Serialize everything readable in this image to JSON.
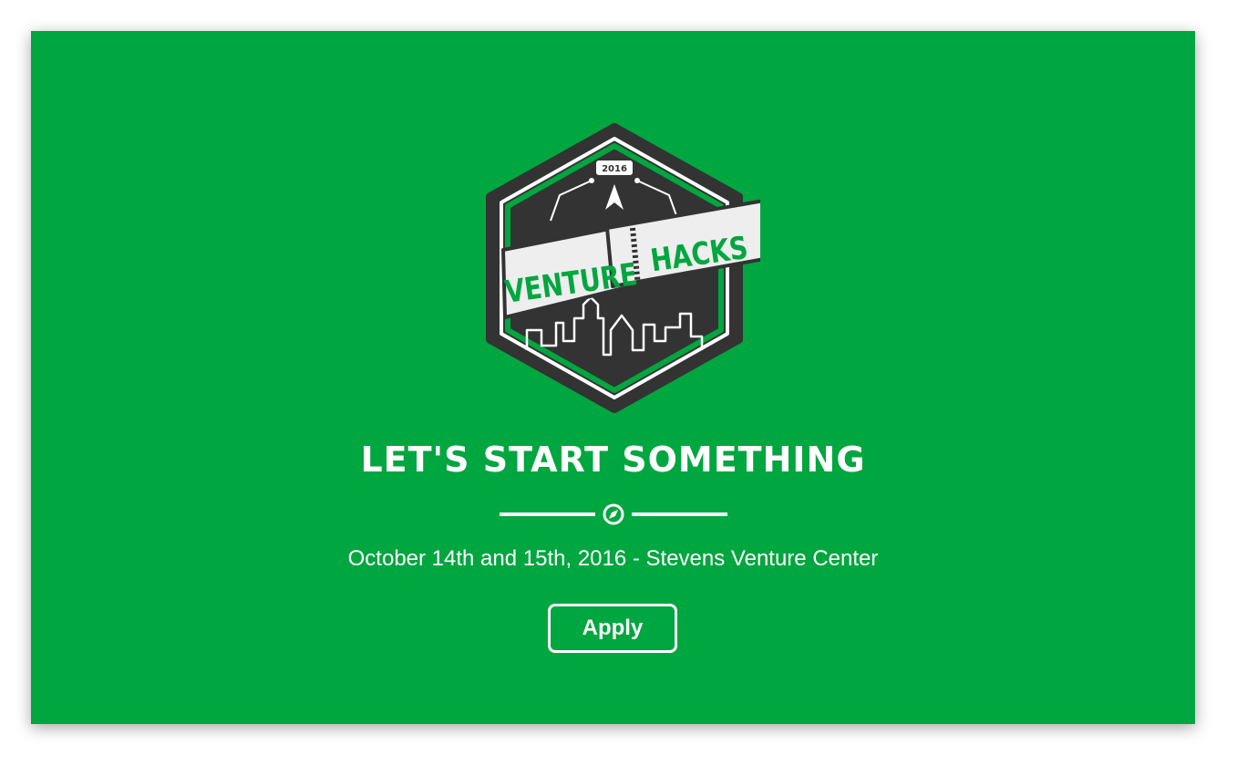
{
  "colors": {
    "background": "#00a63f",
    "badge_dark": "#333333",
    "badge_green": "#00a63f",
    "text": "#ffffff"
  },
  "logo": {
    "year": "2016",
    "word_left": "VENTURE",
    "word_right": "HACKS"
  },
  "hero": {
    "headline": "LET'S START SOMETHING",
    "divider_icon": "compass-icon",
    "subtitle": "October 14th and 15th, 2016 - Stevens Venture Center",
    "apply_label": "Apply"
  }
}
